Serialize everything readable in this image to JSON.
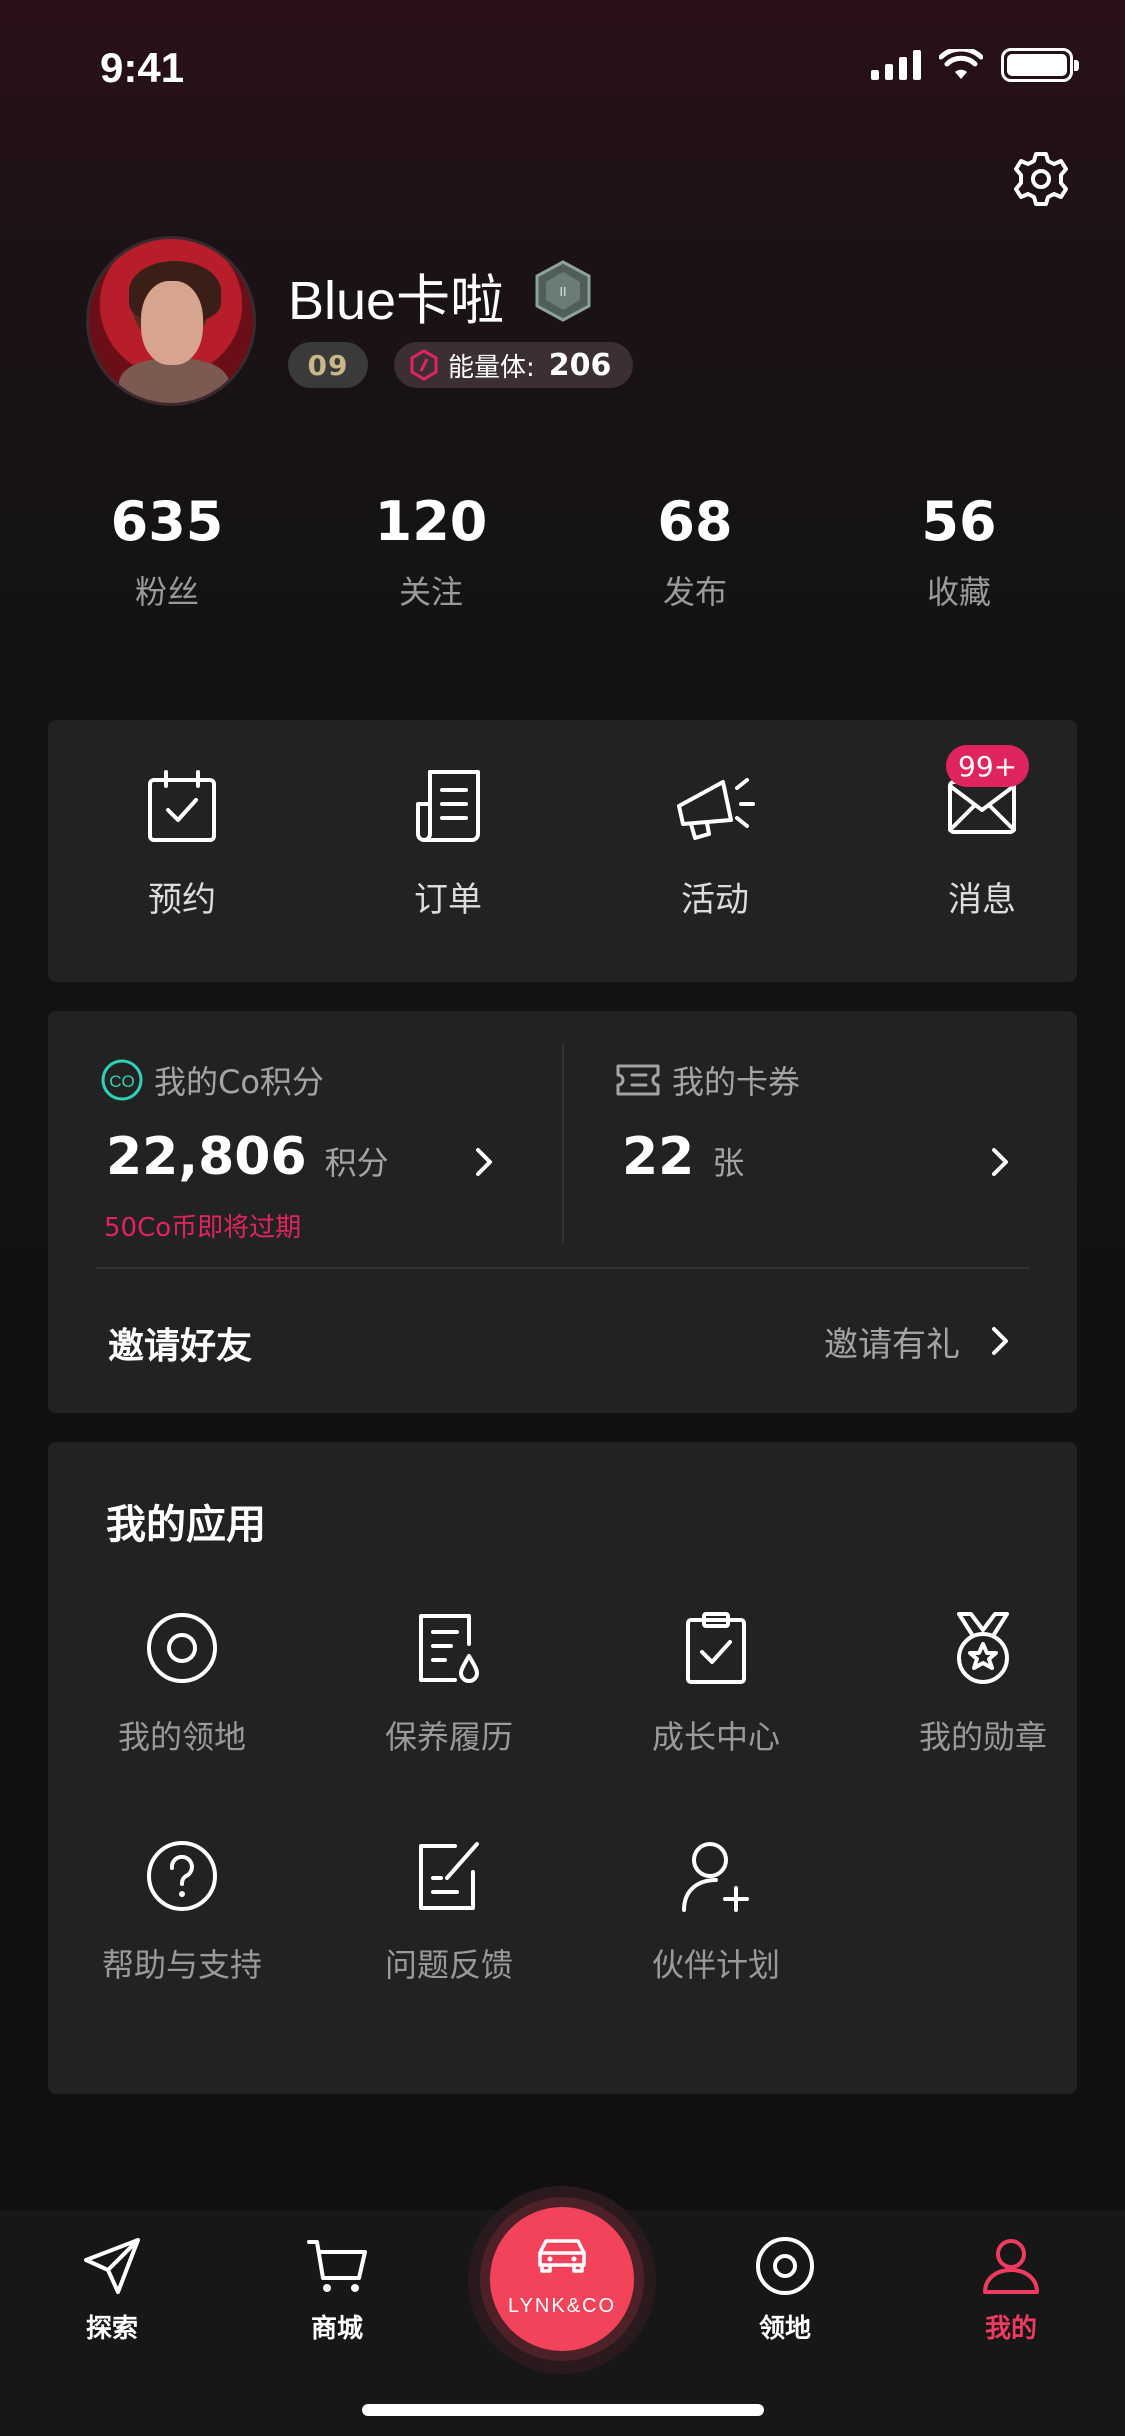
{
  "status_bar": {
    "time": "9:41"
  },
  "profile": {
    "username": "Blue卡啦",
    "level": "09",
    "energy_label": "能量体:",
    "energy_value": "206"
  },
  "stats": [
    {
      "value": "635",
      "label": "粉丝"
    },
    {
      "value": "120",
      "label": "关注"
    },
    {
      "value": "68",
      "label": "发布"
    },
    {
      "value": "56",
      "label": "收藏"
    }
  ],
  "quick_actions": [
    {
      "label": "预约",
      "icon": "calendar-check-icon"
    },
    {
      "label": "订单",
      "icon": "document-list-icon"
    },
    {
      "label": "活动",
      "icon": "megaphone-icon"
    },
    {
      "label": "消息",
      "icon": "envelope-icon"
    }
  ],
  "message_badge": "99+",
  "points": {
    "co_title": "我的Co积分",
    "co_icon_text": "CO",
    "co_value": "22,806",
    "co_unit": "积分",
    "co_warning": "50Co币即将过期",
    "coupon_title": "我的卡券",
    "coupon_value": "22",
    "coupon_unit": "张",
    "invite_label": "邀请好友",
    "invite_action": "邀请有礼"
  },
  "apps": {
    "title": "我的应用",
    "items": [
      {
        "label": "我的领地",
        "icon": "territory-target-icon"
      },
      {
        "label": "保养履历",
        "icon": "maintenance-record-icon"
      },
      {
        "label": "成长中心",
        "icon": "clipboard-check-icon"
      },
      {
        "label": "我的勋章",
        "icon": "medal-icon"
      },
      {
        "label": "帮助与支持",
        "icon": "help-question-icon"
      },
      {
        "label": "问题反馈",
        "icon": "feedback-edit-icon"
      },
      {
        "label": "伙伴计划",
        "icon": "add-partner-icon"
      }
    ]
  },
  "tabbar": {
    "items": [
      {
        "label": "探索",
        "icon": "paper-plane-icon"
      },
      {
        "label": "商城",
        "icon": "shopping-cart-icon"
      },
      {
        "label": "领地",
        "icon": "territory-icon"
      },
      {
        "label": "我的",
        "icon": "user-icon"
      }
    ],
    "center_brand": "LYNK&CO",
    "active": "我的"
  },
  "colors": {
    "accent": "#f03b60",
    "badge": "#e0245e",
    "co_icon": "#2ed3b7",
    "card_bg": "#222222"
  }
}
